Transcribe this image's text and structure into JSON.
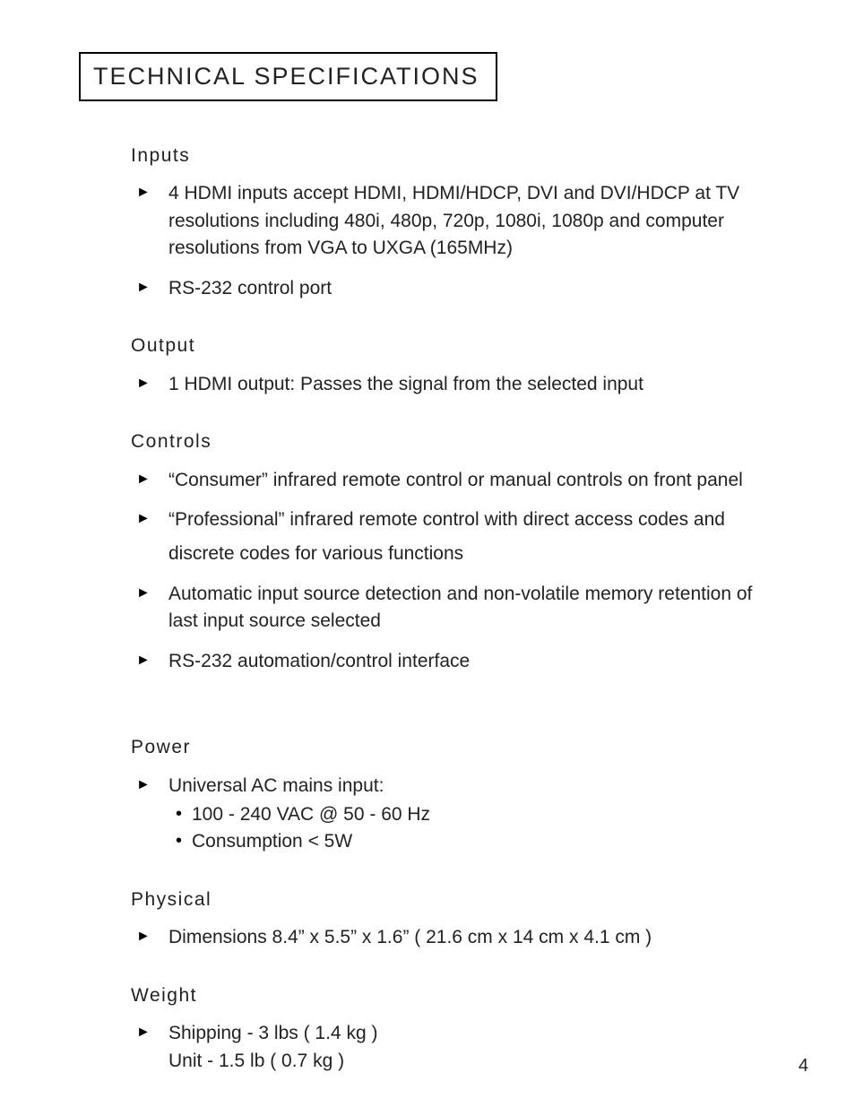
{
  "title": "TECHNICAL SPECIFICATIONS",
  "page_number": "4",
  "sections": [
    {
      "heading": "Inputs",
      "items": [
        {
          "text": "4 HDMI inputs accept HDMI, HDMI/HDCP, DVI and DVI/HDCP at TV resolutions including 480i, 480p, 720p, 1080i, 1080p and computer resolutions from VGA to UXGA (165MHz)"
        },
        {
          "text": "RS-232 control port"
        }
      ]
    },
    {
      "heading": "Output",
      "items": [
        {
          "text": "1 HDMI output: Passes the signal from the selected input"
        }
      ]
    },
    {
      "heading": "Controls",
      "items": [
        {
          "text": "“Consumer” infrared remote control or manual controls on front panel"
        },
        {
          "text": "“Professional” infrared remote control with direct access codes and",
          "extra": "discrete codes for various functions"
        },
        {
          "text": "Automatic input source detection and non-volatile memory retention of last input source selected"
        },
        {
          "text": "RS-232 automation/control interface"
        }
      ]
    },
    {
      "heading": "Power",
      "items": [
        {
          "text": "Universal AC mains input:",
          "sub": [
            "100 - 240 VAC @ 50 - 60 Hz",
            "Consumption < 5W"
          ]
        }
      ]
    },
    {
      "heading": "Physical",
      "items": [
        {
          "text": "Dimensions 8.4” x 5.5” x 1.6” ( 21.6 cm x 14 cm x 4.1 cm )"
        }
      ]
    },
    {
      "heading": "Weight",
      "items": [
        {
          "text": "Shipping - 3 lbs ( 1.4 kg )",
          "second": "Unit - 1.5 lb ( 0.7 kg )"
        }
      ]
    }
  ]
}
